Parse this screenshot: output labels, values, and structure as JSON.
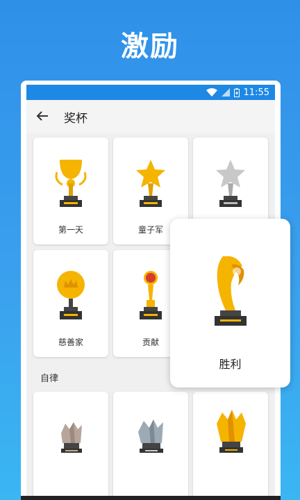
{
  "headline": "激励",
  "status": {
    "time": "11:55"
  },
  "appbar": {
    "title": "奖杯",
    "back_icon": "arrow-left-icon"
  },
  "trophies_row1": [
    {
      "label": "第一天",
      "icon": "gold-cup-trophy-icon"
    },
    {
      "label": "童子军",
      "icon": "gold-star-trophy-icon"
    },
    {
      "label": "",
      "icon": "silver-star-trophy-icon"
    }
  ],
  "trophies_row2": [
    {
      "label": "慈善家",
      "icon": "gold-crown-medal-icon"
    },
    {
      "label": "贡献",
      "icon": "red-ball-trophy-icon"
    }
  ],
  "section_title": "自律",
  "trophies_row3": [
    {
      "label": "",
      "icon": "bronze-crystal-trophy-icon"
    },
    {
      "label": "",
      "icon": "silver-crystal-trophy-icon"
    },
    {
      "label": "",
      "icon": "gold-crystal-trophy-icon"
    }
  ],
  "popup": {
    "label": "胜利",
    "icon": "gold-victory-trophy-icon"
  },
  "colors": {
    "background": "#2f90e8",
    "statusbar": "#1e88e5",
    "gold": "#f5b400"
  }
}
